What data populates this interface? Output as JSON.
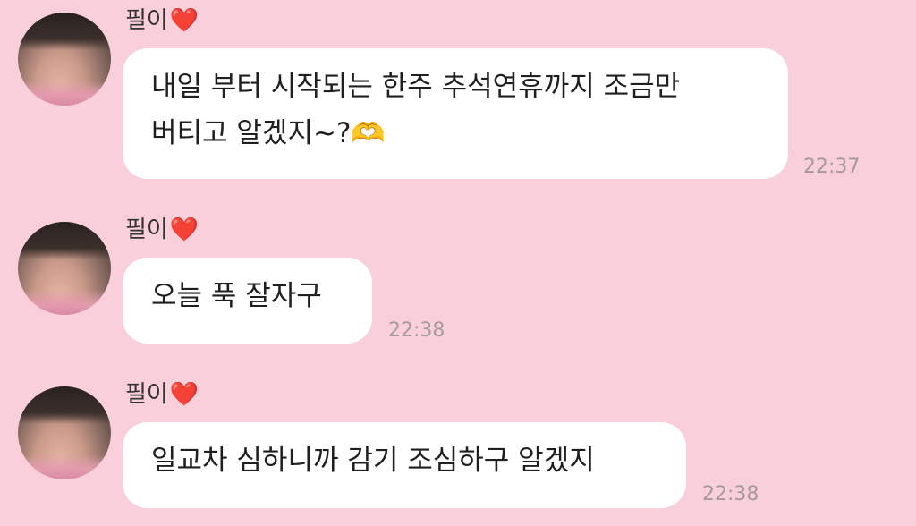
{
  "messages": [
    {
      "sender": "필이",
      "heart": "❤️",
      "lines": [
        "내일 부터 시작되는 한주 추석연휴까지 조금만",
        "버티고 알겠지~?🫶"
      ],
      "time": "22:37"
    },
    {
      "sender": "필이",
      "heart": "❤️",
      "lines": [
        "오늘 푹 잘자구"
      ],
      "time": "22:38"
    },
    {
      "sender": "필이",
      "heart": "❤️",
      "lines": [
        "일교차 심하니까 감기 조심하구 알겠지"
      ],
      "time": "22:38"
    }
  ],
  "colors": {
    "background": "#f8cfda",
    "bubble": "#ffffff",
    "timestamp": "#a59a9d"
  },
  "icons": {
    "avatar": "profile-photo",
    "heart": "heart-emoji"
  }
}
